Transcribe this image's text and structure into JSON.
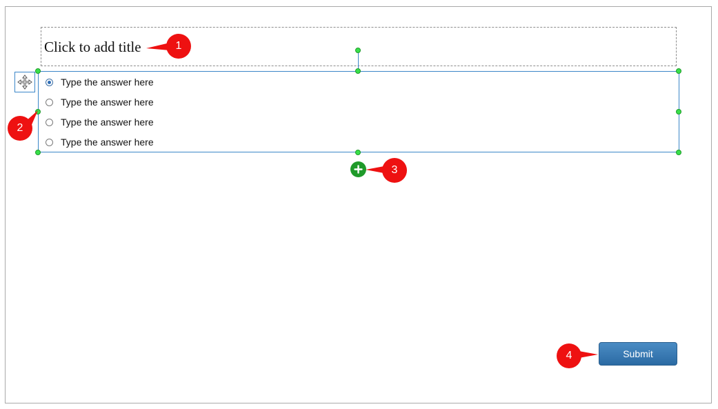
{
  "question": {
    "title_placeholder": "Click to add title",
    "answers": [
      {
        "label": "Type the answer here",
        "selected": true
      },
      {
        "label": "Type the answer here",
        "selected": false
      },
      {
        "label": "Type the answer here",
        "selected": false
      },
      {
        "label": "Type the answer here",
        "selected": false
      }
    ]
  },
  "submit_label": "Submit",
  "callouts": [
    "1",
    "2",
    "3",
    "4"
  ],
  "icons": {
    "move": "move-icon",
    "add": "plus-icon"
  },
  "colors": {
    "selection_border": "#3a86c8",
    "handle": "#39e04a",
    "add_button": "#1f9a2a",
    "callout": "#ee1111",
    "submit": "#2b6aa3"
  }
}
